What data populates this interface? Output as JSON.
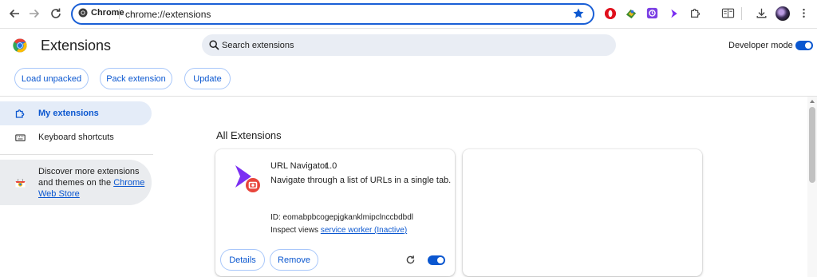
{
  "omnibox": {
    "chip_label": "Chrome",
    "url": "chrome://extensions"
  },
  "toolbar_icons": [
    "back-icon",
    "forward-icon",
    "reload-icon",
    "bookmark-star-icon",
    "opera-extension-icon",
    "puzzle-map-extension-icon",
    "purple-extension-icon",
    "url-navigator-extension-icon",
    "extensions-puzzle-icon",
    "reading-list-icon",
    "downloads-icon",
    "profile-avatar-icon",
    "more-menu-icon"
  ],
  "header": {
    "title": "Extensions",
    "search_placeholder": "Search extensions",
    "developer_mode_label": "Developer mode",
    "developer_mode_on": true
  },
  "actions": {
    "load_unpacked": "Load unpacked",
    "pack_extension": "Pack extension",
    "update": "Update"
  },
  "sidebar": {
    "items": [
      {
        "label": "My extensions",
        "active": true
      },
      {
        "label": "Keyboard shortcuts",
        "active": false
      }
    ],
    "promo": {
      "text": "Discover more extensions and themes on the ",
      "link": "Chrome Web Store"
    }
  },
  "main": {
    "section_title": "All Extensions",
    "extensions": [
      {
        "name": "URL Navigator",
        "version": "1.0",
        "description": "Navigate through a list of URLs in a single tab.",
        "id_label": "ID: eomabpbcogepjgkanklmipclnccbdbdl",
        "inspect_label": "Inspect views",
        "inspect_link": "service worker (Inactive)",
        "details_label": "Details",
        "remove_label": "Remove",
        "enabled": true
      }
    ]
  },
  "colors": {
    "accent": "#0b57d0",
    "omnibox_border": "#1a5fd6",
    "active_nav_bg": "#e4ecf8",
    "search_bg": "#e9edf4"
  }
}
